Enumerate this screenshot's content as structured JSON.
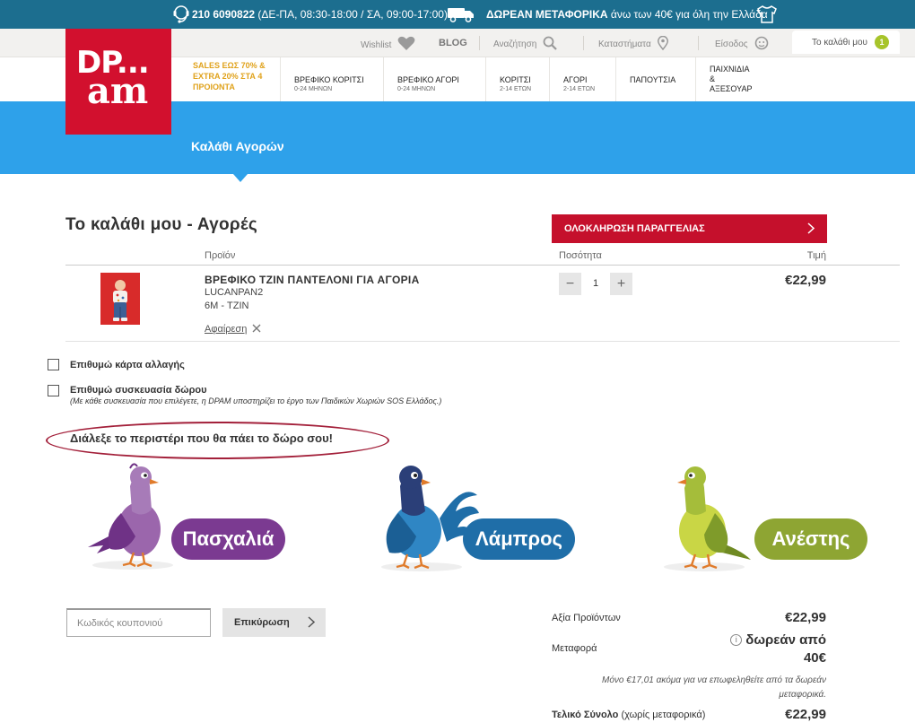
{
  "topbar": {
    "phone": "210 6090822",
    "hours": "(ΔΕ-ΠΑ, 08:30-18:00 / ΣΑ, 09:00-17:00)",
    "free_shipping_strong": "ΔΩΡΕΑΝ ΜΕΤΑΦΟΡΙΚΑ",
    "free_shipping_rest": "άνω των 40€ για όλη την Ελλάδα"
  },
  "utility": {
    "wishlist": "Wishlist",
    "blog": "BLOG",
    "search": "Αναζήτηση",
    "stores": "Καταστήματα",
    "login": "Είσοδος",
    "cart": "Το καλάθι μου",
    "cart_count": "1"
  },
  "logo": {
    "line1": "DP...",
    "line2": "am"
  },
  "nav": {
    "promo": "SALES ΕΩΣ 70% & EXTRA 20% ΣΤΑ 4 ΠΡΟΙΟΝΤΑ",
    "items": [
      {
        "label": "ΒΡΕΦΙΚΟ ΚΟΡΙΤΣΙ",
        "sub": "0-24 ΜΗΝΩΝ"
      },
      {
        "label": "ΒΡΕΦΙΚΟ ΑΓΟΡΙ",
        "sub": "0-24 ΜΗΝΩΝ"
      },
      {
        "label": "ΚΟΡΙΤΣΙ",
        "sub": "2-14 ΕΤΩΝ"
      },
      {
        "label": "ΑΓΟΡΙ",
        "sub": "2-14 ΕΤΩΝ"
      },
      {
        "label": "ΠΑΠΟΥΤΣΙΑ",
        "sub": ""
      },
      {
        "label_lines": [
          "ΠΑΙΧΝΙΔΙΑ",
          "&",
          "ΑΞΕΣΟΥΑΡ"
        ]
      }
    ]
  },
  "banner": {
    "title": "Καλάθι Αγορών"
  },
  "cart": {
    "title": "Το καλάθι μου - Αγορές",
    "checkout": "ΟΛΟΚΛΗΡΩΣΗ ΠΑΡΑΓΓΕΛΙΑΣ",
    "headers": {
      "product": "Προϊόν",
      "quantity": "Ποσότητα",
      "price": "Τιμή"
    },
    "item": {
      "name": "ΒΡΕΦΙΚΟ ΤΖΙΝ ΠΑΝΤΕΛΟΝΙ ΓΙΑ ΑΓΟΡΙΑ",
      "code": "LUCANPAN2",
      "variant": "6M - ΤΖΙΝ",
      "remove": "Αφαίρεση",
      "quantity": "1",
      "price": "€22,99"
    }
  },
  "options": {
    "gift_card": "Επιθυμώ κάρτα αλλαγής",
    "gift_wrap": "Επιθυμώ συσκευασία δώρου",
    "gift_wrap_note": "(Με κάθε συσκευασία που επιλέγετε, η DPAM υποστηρίζει το έργο των Παιδικών Χωριών SOS Ελλάδος.)"
  },
  "pigeons": {
    "title": "Διάλεξε το περιστέρι που θα πάει το δώρο σου!",
    "choices": [
      {
        "name": "Πασχαλιά",
        "color": "#7b3a91"
      },
      {
        "name": "Λάμπρος",
        "color": "#1f6ea8"
      },
      {
        "name": "Ανέστης",
        "color": "#8ea533"
      }
    ]
  },
  "coupon": {
    "placeholder": "Κωδικός κουπονιού",
    "apply": "Επικύρωση"
  },
  "summary": {
    "products_label": "Αξία Προϊόντων",
    "products_value": "€22,99",
    "shipping_label": "Μεταφορά",
    "shipping_value_l1": "δωρεάν από",
    "shipping_value_l2": "40€",
    "shipping_note": "Μόνο €17,01 ακόμα για να επωφεληθείτε από τα δωρεάν μεταφορικά.",
    "total_label": "Τελικό Σύνολο",
    "total_suffix": "(χωρίς μεταφορικά)",
    "total_value": "€22,99"
  },
  "colors": {
    "topbar": "#1c6e8f",
    "brand_red": "#d2102e",
    "banner_blue": "#2ea1ea",
    "checkout_red": "#c5102c",
    "cart_badge": "#a7c42a"
  }
}
